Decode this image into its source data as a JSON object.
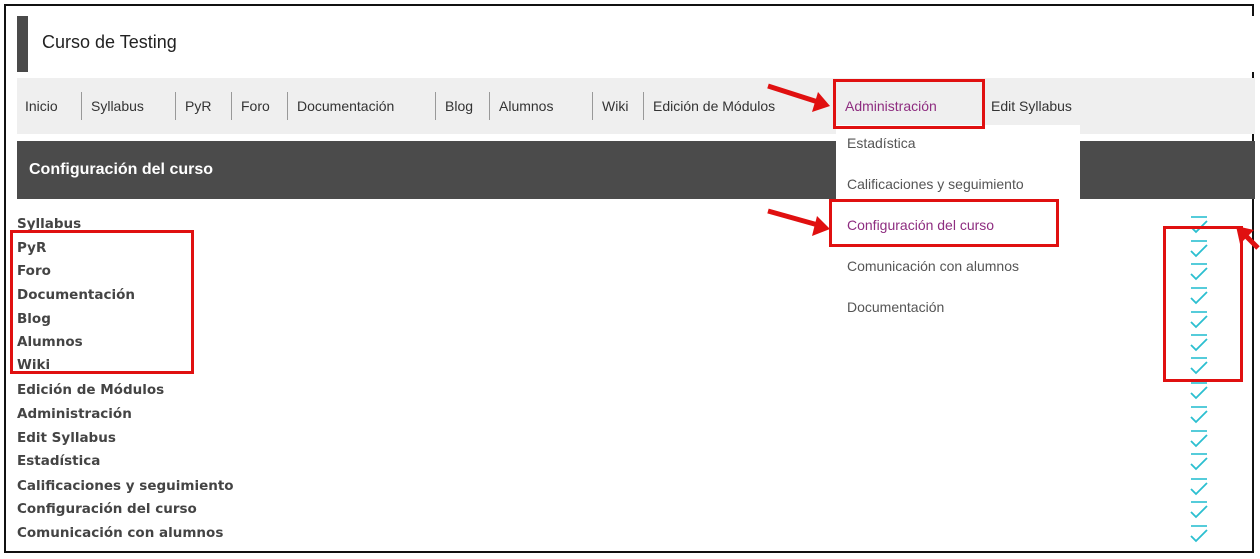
{
  "course": {
    "title": "Curso de Testing"
  },
  "nav": {
    "items": [
      {
        "label": "Inicio"
      },
      {
        "label": "Syllabus"
      },
      {
        "label": "PyR"
      },
      {
        "label": "Foro"
      },
      {
        "label": "Documentación"
      },
      {
        "label": "Blog"
      },
      {
        "label": "Alumnos"
      },
      {
        "label": "Wiki"
      },
      {
        "label": "Edición de Módulos"
      },
      {
        "label": "Administración"
      },
      {
        "label": "Edit Syllabus"
      }
    ]
  },
  "dropdown": {
    "items": [
      {
        "label": "Estadística"
      },
      {
        "label": "Calificaciones y seguimiento"
      },
      {
        "label": "Configuración del curso"
      },
      {
        "label": "Comunicación con alumnos"
      },
      {
        "label": "Documentación"
      }
    ]
  },
  "section": {
    "title": "Configuración del curso"
  },
  "config": {
    "items": [
      {
        "label": "Syllabus",
        "enabled": true
      },
      {
        "label": "PyR",
        "enabled": true
      },
      {
        "label": "Foro",
        "enabled": true
      },
      {
        "label": "Documentación",
        "enabled": true
      },
      {
        "label": "Blog",
        "enabled": true
      },
      {
        "label": "Alumnos",
        "enabled": true
      },
      {
        "label": "Wiki",
        "enabled": true
      },
      {
        "label": "Edición de Módulos",
        "enabled": true
      },
      {
        "label": "Administración",
        "enabled": true
      },
      {
        "label": "Edit Syllabus",
        "enabled": true
      },
      {
        "label": "Estadística",
        "enabled": true
      },
      {
        "label": "Calificaciones y seguimiento",
        "enabled": true
      },
      {
        "label": "Configuración del curso",
        "enabled": true
      },
      {
        "label": "Comunicación con alumnos",
        "enabled": true
      }
    ]
  },
  "colors": {
    "accent": "#8e2d80",
    "check": "#2bbfd0",
    "annotation": "#e01010",
    "header_bg": "#4b4b4b"
  }
}
